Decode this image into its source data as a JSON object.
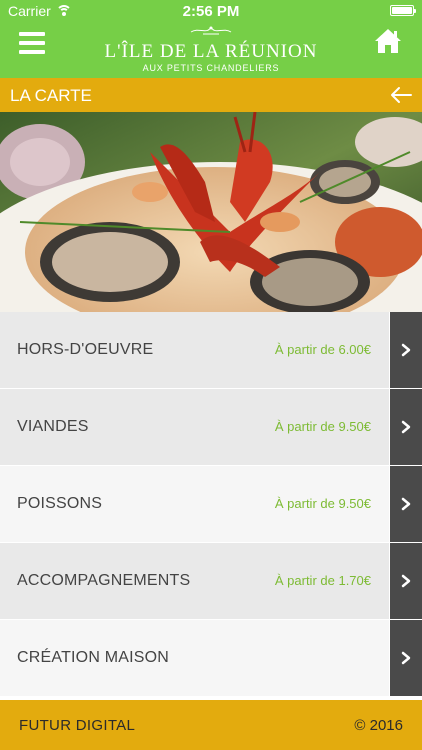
{
  "status_bar": {
    "carrier": "Carrier",
    "time": "2:56 PM",
    "battery_level": 1.0
  },
  "nav": {
    "menu_icon": "hamburger-icon",
    "logo_title": "L'ÎLE DE LA RÉUNION",
    "logo_subtitle": "AUX PETITS CHANDELIERS",
    "home_icon": "home-icon"
  },
  "section": {
    "title": "LA CARTE",
    "back_icon": "arrow-left-icon"
  },
  "menu": {
    "items": [
      {
        "name": "HORS-D'OEUVRE",
        "price": "À partir de 6.00€"
      },
      {
        "name": "VIANDES",
        "price": "À partir de 9.50€"
      },
      {
        "name": "POISSONS",
        "price": "À partir de 9.50€"
      },
      {
        "name": "ACCOMPAGNEMENTS",
        "price": "À partir de 1.70€"
      },
      {
        "name": "CRÉATION MAISON",
        "price": ""
      }
    ]
  },
  "footer": {
    "left": "FUTUR DIGITAL",
    "right": "© 2016"
  },
  "colors": {
    "header_green": "#76cf47",
    "accent_yellow": "#e3ab0e",
    "price_green": "#7dbb34",
    "arrow_bg": "#4a4a4a"
  }
}
